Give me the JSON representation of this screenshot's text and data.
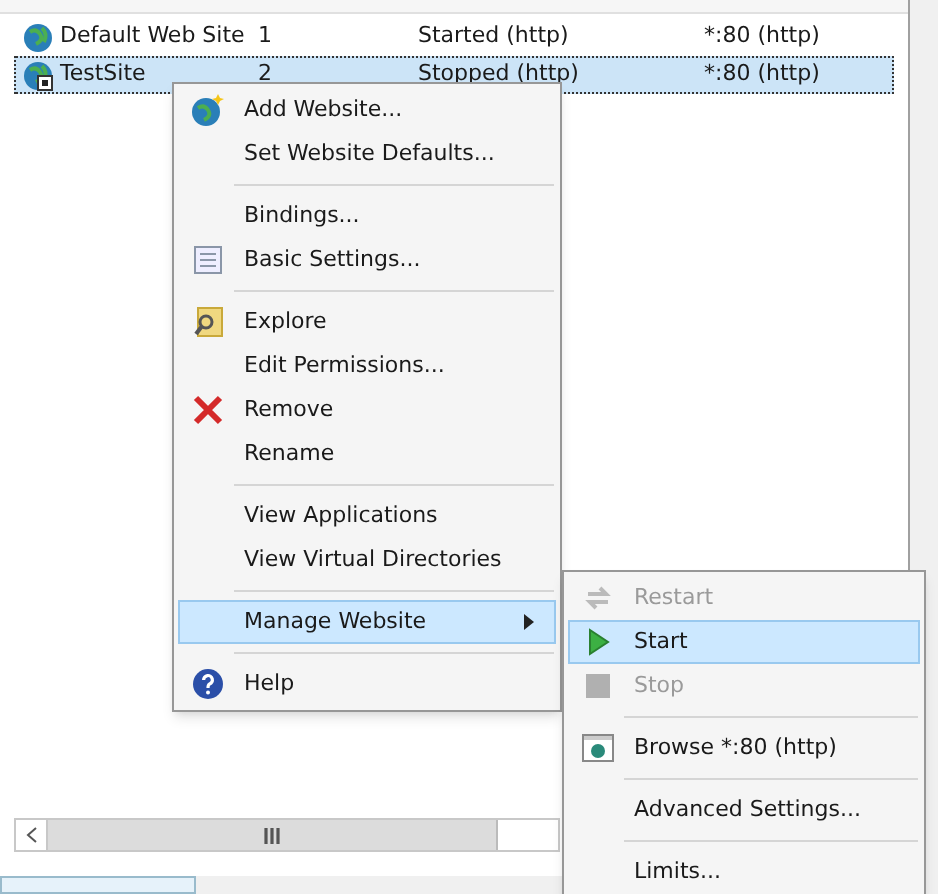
{
  "sites_table": {
    "rows": [
      {
        "name": "Default Web Site",
        "id": "1",
        "status": "Started (http)",
        "binding": "*:80 (http)",
        "selected": false,
        "kind": "started"
      },
      {
        "name": "TestSite",
        "id": "2",
        "status": "Stopped (http)",
        "binding": "*:80 (http)",
        "selected": true,
        "kind": "stopped"
      }
    ]
  },
  "context_menu": {
    "groups": [
      [
        {
          "label": "Add Website...",
          "kind": "globe-add"
        },
        {
          "label": "Set Website Defaults..."
        }
      ],
      [
        {
          "label": "Bindings..."
        },
        {
          "label": "Basic Settings...",
          "kind": "settings"
        }
      ],
      [
        {
          "label": "Explore",
          "kind": "explore"
        },
        {
          "label": "Edit Permissions..."
        },
        {
          "label": "Remove",
          "kind": "remove"
        },
        {
          "label": "Rename"
        }
      ],
      [
        {
          "label": "View Applications"
        },
        {
          "label": "View Virtual Directories"
        }
      ],
      [
        {
          "label": "Manage Website",
          "submenu": true,
          "selected": true
        }
      ],
      [
        {
          "label": "Help",
          "kind": "help"
        }
      ]
    ]
  },
  "submenu": {
    "groups": [
      [
        {
          "label": "Restart",
          "kind": "restart",
          "disabled": true,
          "selected": false
        },
        {
          "label": "Start",
          "kind": "start",
          "disabled": false,
          "selected": true
        },
        {
          "label": "Stop",
          "kind": "stop",
          "disabled": true,
          "selected": false
        }
      ],
      [
        {
          "label": "Browse *:80 (http)",
          "kind": "browse",
          "disabled": false,
          "selected": false
        }
      ],
      [
        {
          "label": "Advanced Settings...",
          "disabled": false,
          "selected": false
        }
      ],
      [
        {
          "label": "Limits...",
          "disabled": false,
          "selected": false
        }
      ]
    ]
  }
}
